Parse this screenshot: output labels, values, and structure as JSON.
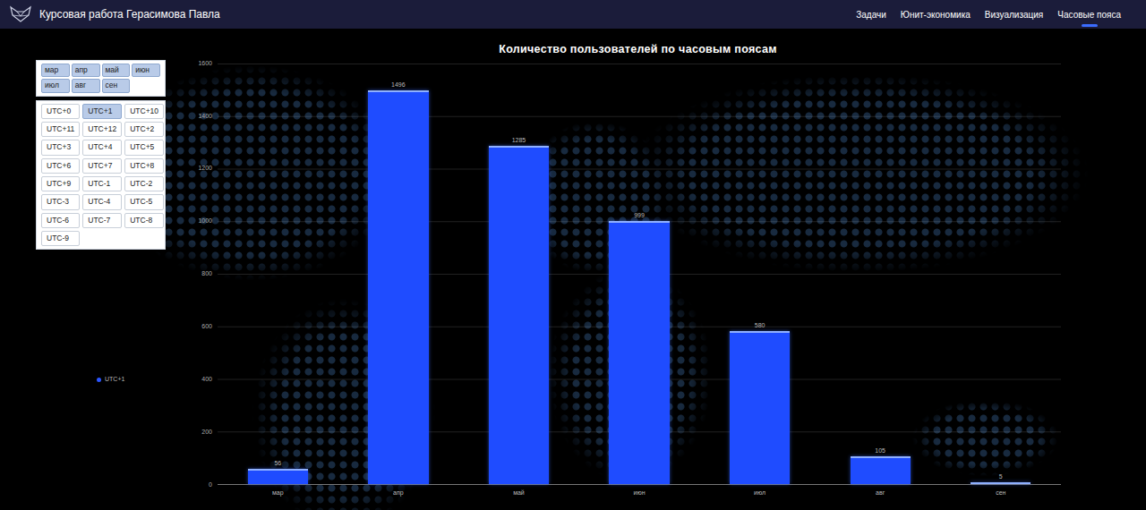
{
  "header": {
    "title": "Курсовая работа Герасимова Павла",
    "nav": [
      {
        "label": "Задачи",
        "selected": false
      },
      {
        "label": "Юнит-экономика",
        "selected": false
      },
      {
        "label": "Визуализация",
        "selected": false
      },
      {
        "label": "Часовые пояса",
        "selected": true
      }
    ]
  },
  "filters": {
    "months": [
      {
        "label": "мар",
        "selected": true
      },
      {
        "label": "апр",
        "selected": true
      },
      {
        "label": "май",
        "selected": true
      },
      {
        "label": "июн",
        "selected": true
      },
      {
        "label": "июл",
        "selected": true
      },
      {
        "label": "авг",
        "selected": true
      },
      {
        "label": "сен",
        "selected": true
      }
    ],
    "timezones": [
      {
        "label": "UTC+0",
        "selected": false
      },
      {
        "label": "UTC+1",
        "selected": true
      },
      {
        "label": "UTC+10",
        "selected": false
      },
      {
        "label": "UTC+11",
        "selected": false
      },
      {
        "label": "UTC+12",
        "selected": false
      },
      {
        "label": "UTC+2",
        "selected": false
      },
      {
        "label": "UTC+3",
        "selected": false
      },
      {
        "label": "UTC+4",
        "selected": false
      },
      {
        "label": "UTC+5",
        "selected": false
      },
      {
        "label": "UTC+6",
        "selected": false
      },
      {
        "label": "UTC+7",
        "selected": false
      },
      {
        "label": "UTC+8",
        "selected": false
      },
      {
        "label": "UTC+9",
        "selected": false
      },
      {
        "label": "UTC-1",
        "selected": false
      },
      {
        "label": "UTC-2",
        "selected": false
      },
      {
        "label": "UTC-3",
        "selected": false
      },
      {
        "label": "UTC-4",
        "selected": false
      },
      {
        "label": "UTC-5",
        "selected": false
      },
      {
        "label": "UTC-6",
        "selected": false
      },
      {
        "label": "UTC-7",
        "selected": false
      },
      {
        "label": "UTC-8",
        "selected": false
      },
      {
        "label": "UTC-9",
        "selected": false
      }
    ]
  },
  "chart": {
    "title": "Количество пользователей по часовым поясам",
    "y_max": 1600,
    "y_ticks": [
      "0",
      "200",
      "400",
      "600",
      "800",
      "1000",
      "1200",
      "1400",
      "1600"
    ],
    "categories": [
      "мар",
      "апр",
      "май",
      "июн",
      "июл",
      "авг",
      "сен"
    ],
    "legend": [
      "UTC+1"
    ],
    "series": [
      {
        "name": "UTC+1",
        "values": [
          56,
          1496,
          1285,
          999,
          580,
          105,
          5
        ],
        "value_labels": [
          "56",
          "1496",
          "1285",
          "999",
          "580",
          "105",
          "5"
        ]
      }
    ]
  }
}
